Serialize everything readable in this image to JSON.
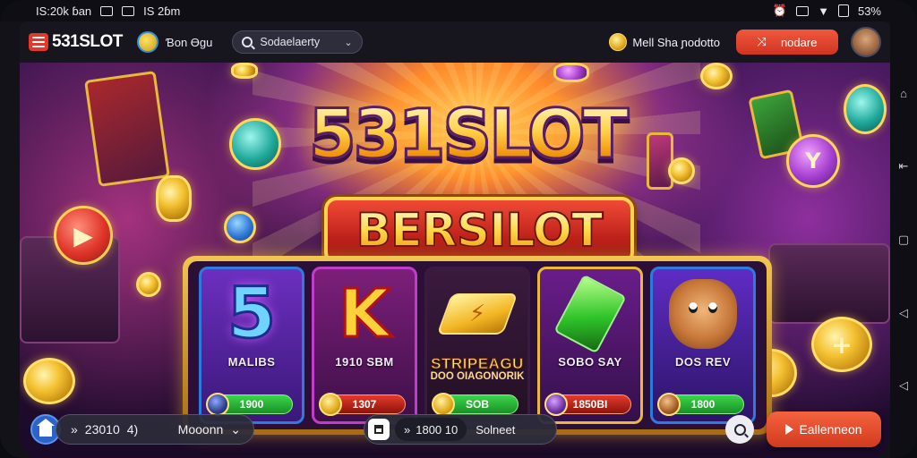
{
  "statusbar": {
    "left_text": "IS:20k ɓan",
    "time": "IS 2ɓm",
    "battery": "53%"
  },
  "topbar": {
    "logo": "531SLOT",
    "user_label": "Ɓon Ɵɡu",
    "search_value": "Sodaelaerty",
    "balance_label": "Mell Sha ɲodotto",
    "cta_label": "nodare"
  },
  "hero": {
    "title": "531SLOT",
    "banner": "BERSILOT"
  },
  "reels": [
    {
      "name": "MALIBS",
      "subtitle": "",
      "button": "1900",
      "symbol": "five-symbol"
    },
    {
      "name": "1910 SBM",
      "subtitle": "",
      "button": "1307",
      "symbol": "k-symbol"
    },
    {
      "name": "STRIPEAGU",
      "subtitle": "DOO OIAGONORIK",
      "button": "SOB",
      "symbol": "bolt-symbol"
    },
    {
      "name": "SOBO SAY",
      "subtitle": "",
      "button": "1850BI",
      "symbol": "gem-symbol"
    },
    {
      "name": "DOS REV",
      "subtitle": "",
      "button": "1800",
      "symbol": "creature-symbol"
    }
  ],
  "bottombar": {
    "left_value": "23010",
    "left_sep": "4)",
    "left_label": "Mooonn",
    "mid_value": "1800 10",
    "mid_label": "Solneet",
    "cta_label": "Eallenneon"
  },
  "colors": {
    "accent_red": "#e2392c",
    "gold": "#ffd24a",
    "bg_purple": "#3a1652"
  },
  "icons": [
    "envelope-icon",
    "gallery-icon",
    "alarm-icon",
    "wifi-icon",
    "battery-icon",
    "search-icon",
    "coin-icon",
    "home-icon",
    "play-icon",
    "back-icon",
    "recents-icon"
  ]
}
